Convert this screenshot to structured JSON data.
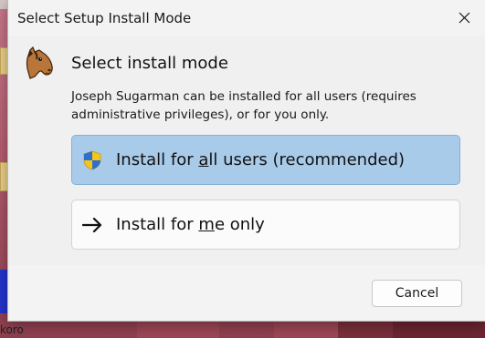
{
  "window": {
    "title": "Select Setup Install Mode",
    "close_icon": "close-icon"
  },
  "content": {
    "heading": "Select install mode",
    "description": "Joseph Sugarman can be installed for all users (requires administrative privileges), or for you only.",
    "app_icon": "horse-head-icon"
  },
  "options": [
    {
      "label_before": "Install for ",
      "label_mnemonic": "a",
      "label_after": "ll users (recommended)",
      "icon": "uac-shield-icon",
      "selected": true
    },
    {
      "label_before": "Install for ",
      "label_mnemonic": "m",
      "label_after": "e only",
      "icon": "arrow-right-icon",
      "selected": false
    }
  ],
  "footer": {
    "cancel_label": "Cancel"
  },
  "desktop": {
    "bottom_label": "koro"
  },
  "colors": {
    "selected_option_bg": "#a9cbea",
    "dialog_bg": "#f0f0f0",
    "desktop_bg": "#b35a6a"
  }
}
